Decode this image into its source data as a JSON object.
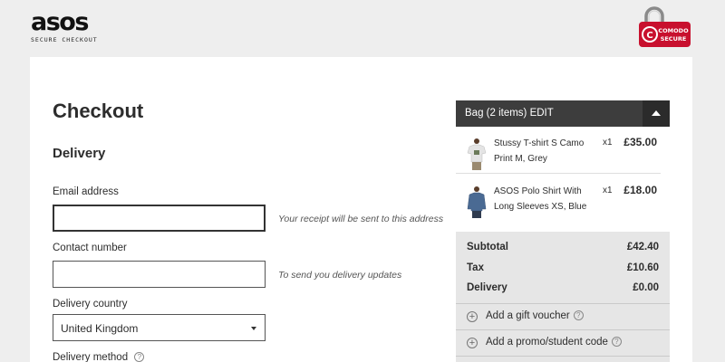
{
  "header": {
    "logo_text": "asos",
    "logo_subtitle": "SECURE CHECKOUT",
    "badge_text": "COMODO SECURE"
  },
  "checkout": {
    "title": "Checkout",
    "section": "Delivery",
    "fields": {
      "email_label": "Email address",
      "email_value": "",
      "email_hint": "Your receipt will be sent to this address",
      "contact_label": "Contact number",
      "contact_value": "",
      "contact_hint": "To send you delivery updates",
      "country_label": "Delivery country",
      "country_value": "United Kingdom",
      "method_label": "Delivery method"
    }
  },
  "bag": {
    "title": "Bag (2 items) EDIT",
    "items": [
      {
        "name": "Stussy T-shirt S Camo Print M, Grey",
        "qty": "x1",
        "price": "£35.00"
      },
      {
        "name": "ASOS Polo Shirt With Long Sleeves XS, Blue",
        "qty": "x1",
        "price": "£18.00"
      }
    ],
    "totals": [
      {
        "label": "Subtotal",
        "value": "£42.40"
      },
      {
        "label": "Tax",
        "value": "£10.60"
      },
      {
        "label": "Delivery",
        "value": "£0.00"
      }
    ],
    "gift_voucher_label": "Add a gift voucher",
    "promo_label": "Add a promo/student code"
  },
  "colors": {
    "page_bg": "#eeeeee",
    "bag_header_bg": "#3d3d3d",
    "totals_bg": "#e6e6e6",
    "badge_red": "#c8102e"
  }
}
